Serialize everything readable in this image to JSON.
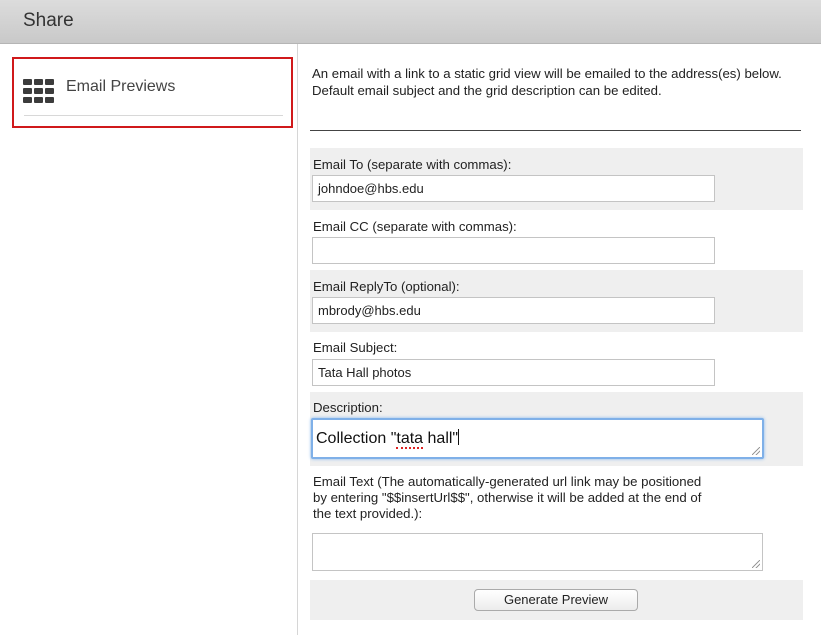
{
  "dialog": {
    "title": "Share"
  },
  "sidebar": {
    "items": [
      {
        "label": "Email Previews",
        "icon": "grid-icon",
        "selected": true
      }
    ]
  },
  "form": {
    "intro": "An email with a link to a static grid view will be emailed to the address(es) below. Default email subject and the grid description can be edited.",
    "email_to": {
      "label": "Email To (separate with commas):",
      "value": "johndoe@hbs.edu"
    },
    "email_cc": {
      "label": "Email CC (separate with commas):",
      "value": ""
    },
    "email_replyto": {
      "label": "Email ReplyTo (optional):",
      "value": "mbrody@hbs.edu"
    },
    "email_subject": {
      "label": "Email Subject:",
      "value": "Tata Hall photos"
    },
    "description": {
      "label": "Description:",
      "value_prefix": "Collection \"",
      "value_misspelled": "tata",
      "value_suffix": " hall\""
    },
    "email_text": {
      "label": "Email Text (The automatically-generated url link may be positioned by entering \"$$insertUrl$$\", otherwise it will be added at the end of the text provided.):",
      "value": ""
    },
    "generate_button": "Generate Preview"
  },
  "colors": {
    "selection_border": "#d0191b",
    "focus_ring": "#7fb0e8",
    "shade": "#efefef"
  }
}
